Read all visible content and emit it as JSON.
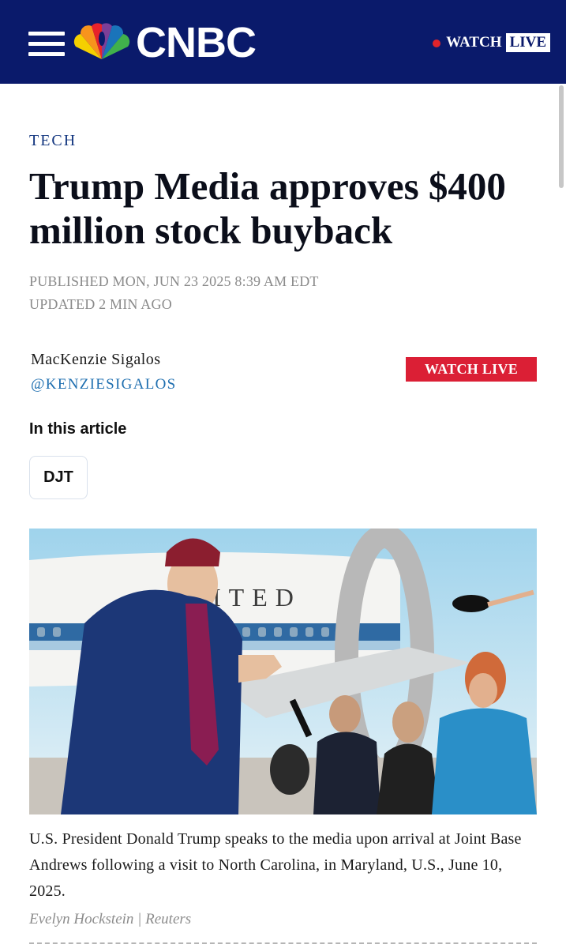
{
  "header": {
    "brand": "CNBC",
    "watch_label": "WATCH",
    "live_label": "LIVE",
    "colors": {
      "bar": "#0a1a6b",
      "live_dot": "#e0242b"
    },
    "icons": [
      "menu-icon",
      "nbc-peacock-icon",
      "live-dot-icon"
    ]
  },
  "article": {
    "section": "TECH",
    "headline_line1": "Trump Media approves $400",
    "headline_line2": "million stock buyback",
    "published": "PUBLISHED MON, JUN 23 2025 8:39 AM EDT",
    "updated": "UPDATED 2 MIN AGO",
    "author": "MacKenzie Sigalos",
    "handle": "@KENZIESIGALOS",
    "watch_live_button": "WATCH LIVE",
    "in_this_article": "In this article",
    "tickers": [
      "DJT"
    ],
    "image": {
      "caption": "U.S. President Donald Trump speaks to the media upon arrival at Joint Base Andrews following a visit to North Carolina, in Maryland, U.S., June 10, 2025.",
      "credit": "Evelyn Hockstein | Reuters",
      "aircraft_lettering": "ITED"
    }
  },
  "colors": {
    "accent_red": "#db1f35",
    "section_blue": "#13367f",
    "link_blue": "#1f6fb0"
  }
}
